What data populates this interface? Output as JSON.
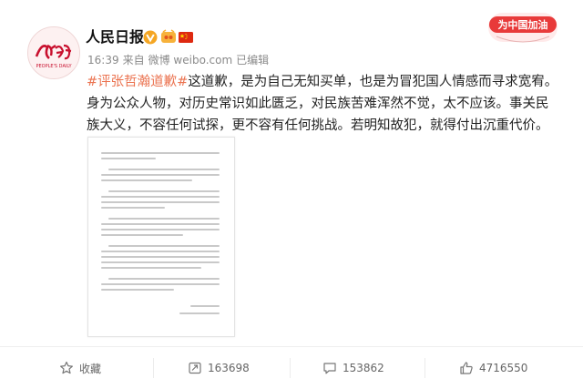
{
  "header": {
    "username": "人民日报",
    "time": "16:39",
    "source_prefix": "来自",
    "source": "微博 weibo.com",
    "edited": "已编辑",
    "banner_text": "为中国加油",
    "avatar_logo_text": "人民日報",
    "avatar_sub_text": "PEOPLE'S DAILY"
  },
  "post": {
    "hashtag": "#评张哲瀚道歉#",
    "text": "这道歉，是为自己无知买单，也是为冒犯国人情感而寻求宽宥。身为公众人物，对历史常识如此匮乏，对民族苦难浑然不觉，太不应该。事关民族大义，不容任何试探，更不容有任何挑战。若明知故犯，就得付出沉重代价。"
  },
  "actions": {
    "favorite": "收藏",
    "repost": "163698",
    "comment": "153862",
    "like": "4716550"
  },
  "icons": [
    "verified-icon",
    "member-icon",
    "china-flag-icon",
    "favorite-icon",
    "repost-icon",
    "comment-icon",
    "like-icon"
  ],
  "colors": {
    "hashtag": "#eb7350",
    "brand_red": "#d81e06",
    "verified": "#f5a623"
  }
}
